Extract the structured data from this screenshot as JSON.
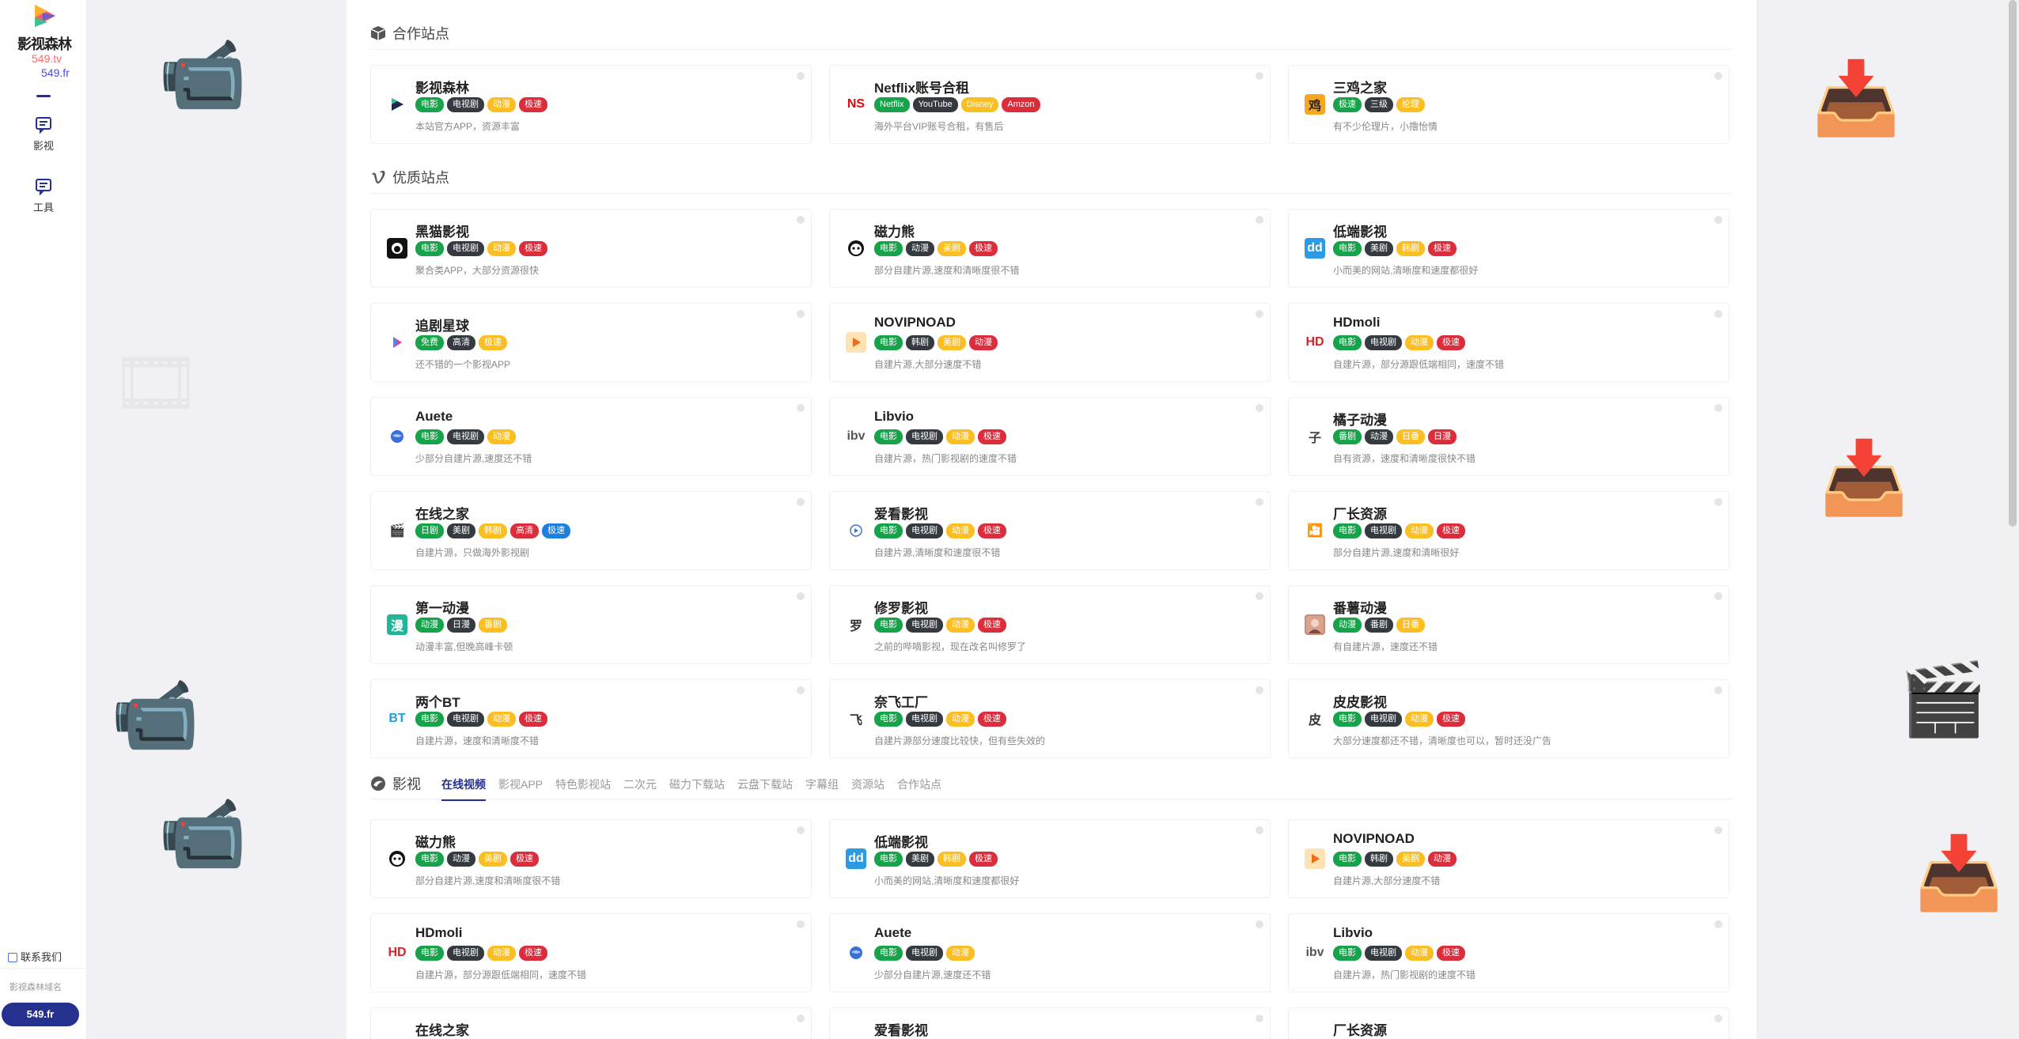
{
  "brand": {
    "title": "影视森林",
    "domain1": "549.tv",
    "domain2": "549.fr"
  },
  "sidebar": {
    "items": [
      {
        "label": "影视",
        "icon": "message-icon"
      },
      {
        "label": "工具",
        "icon": "message-icon"
      }
    ],
    "contact": "联系我们",
    "domain_label": "影视森林域名",
    "domain_button": "549.fr"
  },
  "sections": {
    "partner": {
      "title": "合作站点",
      "icon": "box-icon"
    },
    "quality": {
      "title": "优质站点",
      "icon": "vimeo-icon"
    },
    "video": {
      "title": "影视",
      "icon": "film-icon"
    }
  },
  "tabs": [
    "在线视频",
    "影视APP",
    "特色影视站",
    "二次元",
    "磁力下载站",
    "云盘下载站",
    "字幕组",
    "资源站",
    "合作站点"
  ],
  "colors": {
    "green": "#16a34a",
    "dark": "#343a40",
    "yellow": "#fbbf24",
    "red": "#dc2d3c",
    "blue": "#1d7fe0",
    "accent": "#24318f"
  },
  "partner_cards": [
    {
      "name": "影视森林",
      "icon": "play-logo-icon",
      "tags": [
        [
          "电影",
          "green"
        ],
        [
          "电视剧",
          "dark"
        ],
        [
          "动漫",
          "yellow"
        ],
        [
          "极速",
          "red"
        ]
      ],
      "desc": "本站官方APP，资源丰富"
    },
    {
      "name": "Netflix账号合租",
      "icon": "netflix-icon",
      "icon_text": "NS",
      "tags": [
        [
          "Netflix",
          "green"
        ],
        [
          "YouTube",
          "dark"
        ],
        [
          "Disney",
          "yellow"
        ],
        [
          "Amzon",
          "red"
        ]
      ],
      "desc": "海外平台VIP账号合租，有售后"
    },
    {
      "name": "三鸡之家",
      "icon": "chicken-icon",
      "icon_text": "鸡",
      "tags": [
        [
          "极速",
          "green"
        ],
        [
          "三级",
          "dark"
        ],
        [
          "伦理",
          "yellow"
        ]
      ],
      "desc": "有不少伦理片，小撸怡情"
    }
  ],
  "quality_cards": [
    {
      "name": "黑猫影视",
      "icon": "github-icon",
      "tags": [
        [
          "电影",
          "green"
        ],
        [
          "电视剧",
          "dark"
        ],
        [
          "动漫",
          "yellow"
        ],
        [
          "极速",
          "red"
        ]
      ],
      "desc": "聚合类APP，大部分资源很快"
    },
    {
      "name": "磁力熊",
      "icon": "panda-icon",
      "tags": [
        [
          "电影",
          "green"
        ],
        [
          "动漫",
          "dark"
        ],
        [
          "美剧",
          "yellow"
        ],
        [
          "极速",
          "red"
        ]
      ],
      "desc": "部分自建片源,速度和清晰度很不错"
    },
    {
      "name": "低端影视",
      "icon": "dd-icon",
      "icon_text": "dd",
      "tags": [
        [
          "电影",
          "green"
        ],
        [
          "美剧",
          "dark"
        ],
        [
          "韩剧",
          "yellow"
        ],
        [
          "极速",
          "red"
        ]
      ],
      "desc": "小而美的网站,清晰度和速度都很好"
    },
    {
      "name": "追剧星球",
      "icon": "play-store-icon",
      "tags": [
        [
          "免费",
          "green"
        ],
        [
          "高清",
          "dark"
        ],
        [
          "极速",
          "yellow"
        ]
      ],
      "desc": "还不错的一个影视APP"
    },
    {
      "name": "NOVIPNOAD",
      "icon": "play-button-icon",
      "tags": [
        [
          "电影",
          "green"
        ],
        [
          "韩剧",
          "dark"
        ],
        [
          "美剧",
          "yellow"
        ],
        [
          "动漫",
          "red"
        ]
      ],
      "desc": "自建片源,大部分速度不错"
    },
    {
      "name": "HDmoli",
      "icon": "hd-icon",
      "icon_text": "HD",
      "tags": [
        [
          "电影",
          "green"
        ],
        [
          "电视剧",
          "dark"
        ],
        [
          "动漫",
          "yellow"
        ],
        [
          "极速",
          "red"
        ]
      ],
      "desc": "自建片源，部分源跟低端相同，速度不错"
    },
    {
      "name": "Auete",
      "icon": "globe-icon",
      "tags": [
        [
          "电影",
          "green"
        ],
        [
          "电视剧",
          "dark"
        ],
        [
          "动漫",
          "yellow"
        ]
      ],
      "desc": "少部分自建片源,速度还不错"
    },
    {
      "name": "Libvio",
      "icon": "libvio-icon",
      "icon_text": "ibv",
      "tags": [
        [
          "电影",
          "green"
        ],
        [
          "电视剧",
          "dark"
        ],
        [
          "动漫",
          "yellow"
        ],
        [
          "极速",
          "red"
        ]
      ],
      "desc": "自建片源，热门影视剧的速度不错"
    },
    {
      "name": "橘子动漫",
      "icon": "orange-icon",
      "icon_text": "子",
      "tags": [
        [
          "番剧",
          "green"
        ],
        [
          "动漫",
          "dark"
        ],
        [
          "日番",
          "yellow"
        ],
        [
          "日漫",
          "red"
        ]
      ],
      "desc": "自有资源，速度和清晰度很快不错"
    },
    {
      "name": "在线之家",
      "icon": "clapper-icon",
      "icon_text": "🎬",
      "tags": [
        [
          "日剧",
          "green"
        ],
        [
          "美剧",
          "dark"
        ],
        [
          "韩剧",
          "yellow"
        ],
        [
          "高清",
          "red"
        ],
        [
          "极速",
          "blue"
        ]
      ],
      "desc": "自建片源，只做海外影视剧"
    },
    {
      "name": "爱看影视",
      "icon": "circle-play-icon",
      "tags": [
        [
          "电影",
          "green"
        ],
        [
          "电视剧",
          "dark"
        ],
        [
          "动漫",
          "yellow"
        ],
        [
          "极速",
          "red"
        ]
      ],
      "desc": "自建片源,清晰度和速度很不错"
    },
    {
      "name": "厂长资源",
      "icon": "factory-icon",
      "icon_text": "🎦",
      "tags": [
        [
          "电影",
          "green"
        ],
        [
          "电视剧",
          "dark"
        ],
        [
          "动漫",
          "yellow"
        ],
        [
          "极速",
          "red"
        ]
      ],
      "desc": "部分自建片源,速度和清晰很好"
    },
    {
      "name": "第一动漫",
      "icon": "manga-icon",
      "icon_text": "漫",
      "tags": [
        [
          "动漫",
          "green"
        ],
        [
          "日漫",
          "dark"
        ],
        [
          "番剧",
          "yellow"
        ]
      ],
      "desc": "动漫丰富,但晚高峰卡顿"
    },
    {
      "name": "修罗影视",
      "icon": "shura-icon",
      "icon_text": "罗",
      "tags": [
        [
          "电影",
          "green"
        ],
        [
          "电视剧",
          "dark"
        ],
        [
          "动漫",
          "yellow"
        ],
        [
          "极速",
          "red"
        ]
      ],
      "desc": "之前的哔嘀影视，现在改名叫修罗了"
    },
    {
      "name": "番薯动漫",
      "icon": "anime-avatar-icon",
      "tags": [
        [
          "动漫",
          "green"
        ],
        [
          "番剧",
          "dark"
        ],
        [
          "日番",
          "yellow"
        ]
      ],
      "desc": "有自建片源，速度还不错"
    },
    {
      "name": "两个BT",
      "icon": "bt-icon",
      "icon_text": "BT",
      "tags": [
        [
          "电影",
          "green"
        ],
        [
          "电视剧",
          "dark"
        ],
        [
          "动漫",
          "yellow"
        ],
        [
          "极速",
          "red"
        ]
      ],
      "desc": "自建片源，速度和清晰度不错"
    },
    {
      "name": "奈飞工厂",
      "icon": "fly-icon",
      "icon_text": "飞",
      "tags": [
        [
          "电影",
          "green"
        ],
        [
          "电视剧",
          "dark"
        ],
        [
          "动漫",
          "yellow"
        ],
        [
          "极速",
          "red"
        ]
      ],
      "desc": "自建片源部分速度比较快，但有些失效的"
    },
    {
      "name": "皮皮影视",
      "icon": "pipi-icon",
      "icon_text": "皮",
      "tags": [
        [
          "电影",
          "green"
        ],
        [
          "电视剧",
          "dark"
        ],
        [
          "动漫",
          "yellow"
        ],
        [
          "极速",
          "red"
        ]
      ],
      "desc": "大部分速度都还不错，清晰度也可以，暂时还没广告"
    }
  ],
  "video_cards": [
    {
      "name": "磁力熊",
      "icon": "panda-icon",
      "tags": [
        [
          "电影",
          "green"
        ],
        [
          "动漫",
          "dark"
        ],
        [
          "美剧",
          "yellow"
        ],
        [
          "极速",
          "red"
        ]
      ],
      "desc": "部分自建片源,速度和清晰度很不错"
    },
    {
      "name": "低端影视",
      "icon": "dd-icon",
      "icon_text": "dd",
      "tags": [
        [
          "电影",
          "green"
        ],
        [
          "美剧",
          "dark"
        ],
        [
          "韩剧",
          "yellow"
        ],
        [
          "极速",
          "red"
        ]
      ],
      "desc": "小而美的网站,清晰度和速度都很好"
    },
    {
      "name": "NOVIPNOAD",
      "icon": "play-button-icon",
      "tags": [
        [
          "电影",
          "green"
        ],
        [
          "韩剧",
          "dark"
        ],
        [
          "美剧",
          "yellow"
        ],
        [
          "动漫",
          "red"
        ]
      ],
      "desc": "自建片源,大部分速度不错"
    },
    {
      "name": "HDmoli",
      "icon": "hd-icon",
      "icon_text": "HD",
      "tags": [
        [
          "电影",
          "green"
        ],
        [
          "电视剧",
          "dark"
        ],
        [
          "动漫",
          "yellow"
        ],
        [
          "极速",
          "red"
        ]
      ],
      "desc": "自建片源，部分源跟低端相同，速度不错"
    },
    {
      "name": "Auete",
      "icon": "globe-icon",
      "tags": [
        [
          "电影",
          "green"
        ],
        [
          "电视剧",
          "dark"
        ],
        [
          "动漫",
          "yellow"
        ]
      ],
      "desc": "少部分自建片源,速度还不错"
    },
    {
      "name": "Libvio",
      "icon": "libvio-icon",
      "icon_text": "ibv",
      "tags": [
        [
          "电影",
          "green"
        ],
        [
          "电视剧",
          "dark"
        ],
        [
          "动漫",
          "yellow"
        ],
        [
          "极速",
          "red"
        ]
      ],
      "desc": "自建片源，热门影视剧的速度不错"
    },
    {
      "name": "在线之家",
      "icon": "clapper-icon",
      "icon_text": "🎬",
      "tags": [],
      "desc": ""
    },
    {
      "name": "爱看影视",
      "icon": "circle-play-icon",
      "tags": [],
      "desc": ""
    },
    {
      "name": "厂长资源",
      "icon": "factory-icon",
      "icon_text": "🎦",
      "tags": [],
      "desc": ""
    }
  ]
}
